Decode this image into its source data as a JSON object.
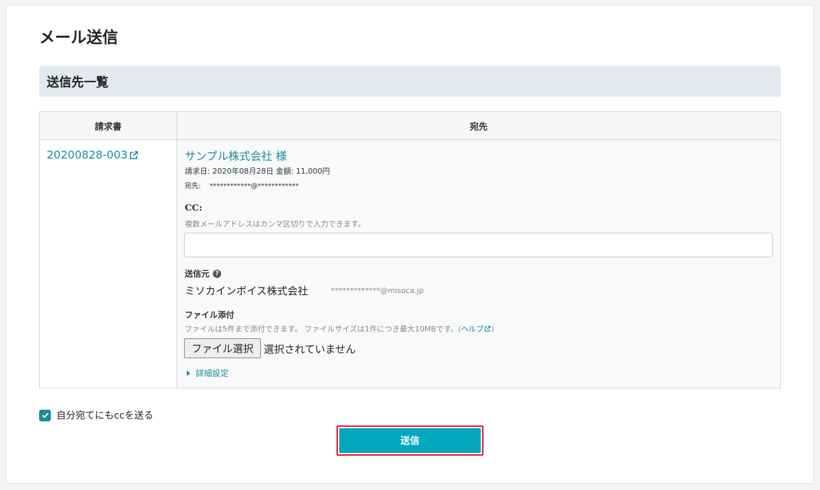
{
  "page": {
    "title": "メール送信"
  },
  "section": {
    "title": "送信先一覧"
  },
  "table": {
    "headers": [
      "請求書",
      "宛先"
    ],
    "row": {
      "invoice_number": "20200828-003",
      "recipient": {
        "company": "サンプル株式会社 様",
        "meta": "請求日: 2020年08月28日 金額: 11,000円",
        "address_line": "宛先:    ************@************",
        "cc": {
          "label": "CC:",
          "help": "複数メールアドレスはカンマ区切りで入力できます。",
          "value": "",
          "placeholder": ""
        },
        "sender": {
          "label": "送信元",
          "name": "ミソカインボイス株式会社",
          "email": "*************@misoca.jp"
        },
        "attachment": {
          "label": "ファイル添付",
          "help_text": "ファイルは5件まで添付できます。 ファイルサイズは1件につき最大10MBです。(",
          "help_link": "ヘルプ",
          "help_close": ")",
          "button_label": "ファイル選択",
          "status": "選択されていません"
        },
        "advanced": {
          "label": "詳細設定"
        }
      }
    }
  },
  "cc_self": {
    "label": "自分宛てにもccを送る",
    "checked": true
  },
  "send_button": {
    "label": "送信"
  },
  "colors": {
    "accent": "#1a8c9e",
    "send_button": "#00a7be",
    "highlight_border": "#e0141e"
  }
}
